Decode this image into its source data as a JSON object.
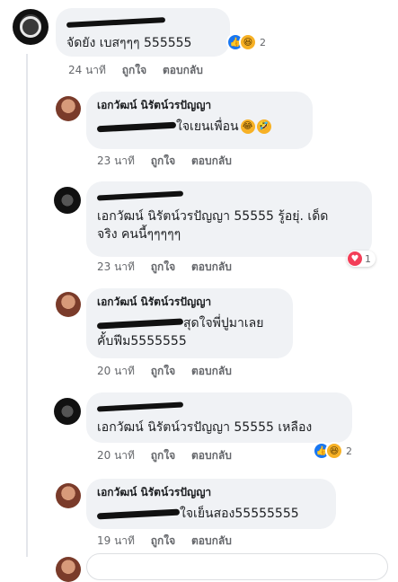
{
  "comments": [
    {
      "name": "",
      "text": "จัดยัง เบสๆๆๆ 555555",
      "time": "24 นาที",
      "like": "ถูกใจ",
      "reply": "ตอบกลับ",
      "reaction_count": "2"
    },
    {
      "name": "เอกวัฒน์ นิรัตน์วรปัญญา",
      "text_after": "ใจเยนเพื่อน",
      "time": "23 นาที",
      "like": "ถูกใจ",
      "reply": "ตอบกลับ"
    },
    {
      "name": "",
      "text_line1": "เอกวัฒน์ นิรัตน์วรปัญญา 55555 รู้อยุ่. เด็ด",
      "text_line2": "จริง คนนี้ๆๆๆๆๆ",
      "time": "23 นาที",
      "like": "ถูกใจ",
      "reply": "ตอบกลับ",
      "reaction_count": "1"
    },
    {
      "name": "เอกวัฒน์ นิรัตน์วรปัญญา",
      "text_after": "สุดใจพี่ปูมาเลย",
      "text_line2": "คั้บฟีม5555555",
      "time": "20 นาที",
      "like": "ถูกใจ",
      "reply": "ตอบกลับ"
    },
    {
      "name": "",
      "text": "เอกวัฒน์ นิรัตน์วรปัญญา 55555 เหลือง",
      "time": "20 นาที",
      "like": "ถูกใจ",
      "reply": "ตอบกลับ",
      "reaction_count": "2"
    },
    {
      "name": "เอกวัฒน์ นิรัตน์วรปัญญา",
      "text_after": "ใจเย็นสอง55555555",
      "time": "19 นาที",
      "like": "ถูกใจ",
      "reply": "ตอบกลับ"
    }
  ],
  "icons": {
    "like": "thumbs-up-icon",
    "haha": "laughing-face-icon",
    "love": "heart-icon"
  },
  "colors": {
    "bubble": "#f0f2f5",
    "meta": "#65676b",
    "like_blue": "#1877f2"
  }
}
